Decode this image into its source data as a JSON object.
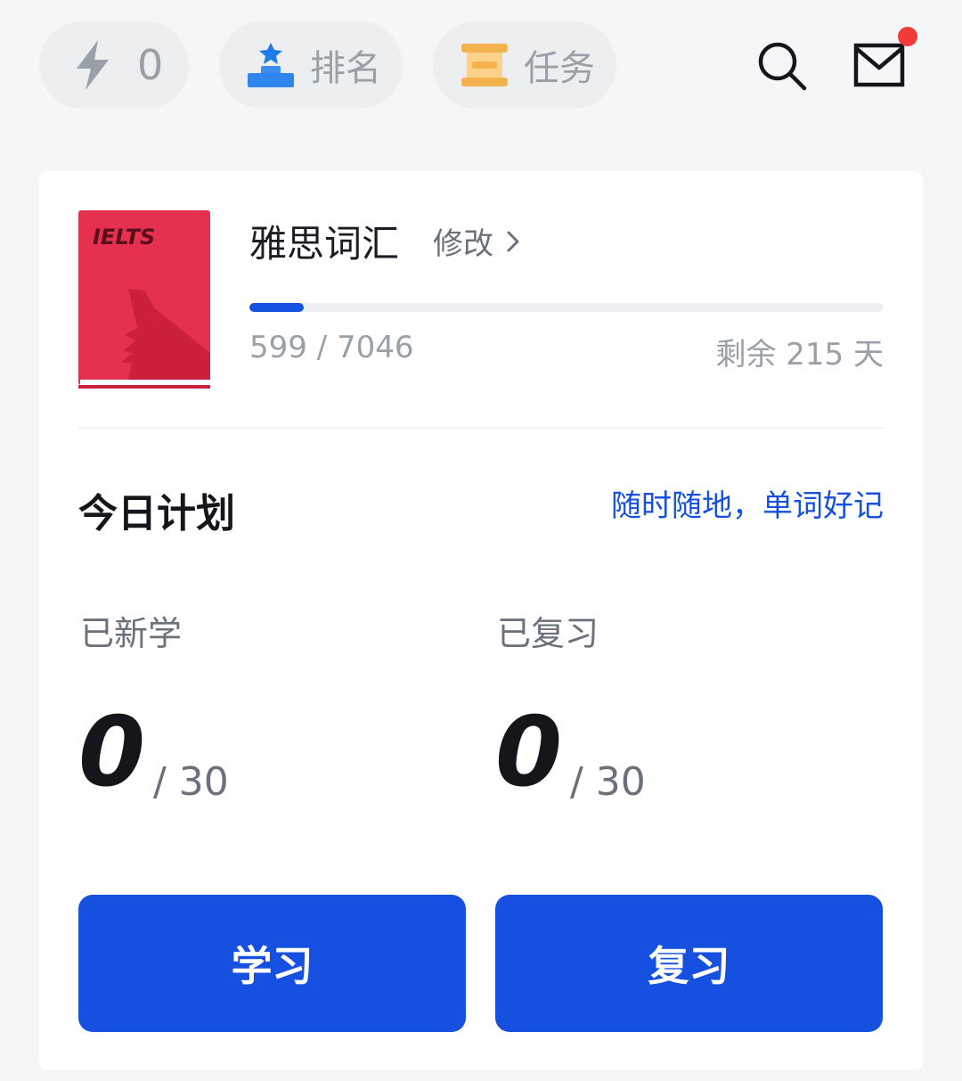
{
  "header": {
    "energy": {
      "icon": "lightning-icon",
      "value": "0"
    },
    "rank": {
      "icon": "podium-star-icon",
      "label": "排名"
    },
    "task": {
      "icon": "scroll-icon",
      "label": "任务"
    },
    "search_icon": "search-icon",
    "mail_icon": "mail-icon",
    "mail_has_notification": true,
    "notification_color": "#f23a3a"
  },
  "book": {
    "cover_text": "IELTS",
    "cover_color": "#e5304f",
    "title": "雅思词汇",
    "edit_label": "修改",
    "progress_current": 599,
    "progress_total": 7046,
    "progress_text": "599 / 7046",
    "remaining_text": "剩余 215 天"
  },
  "plan": {
    "title": "今日计划",
    "slogan": "随时随地，单词好记",
    "new": {
      "label": "已新学",
      "done": "0",
      "total": "/ 30"
    },
    "review": {
      "label": "已复习",
      "done": "0",
      "total": "/ 30"
    },
    "study_button": "学习",
    "review_button": "复习"
  },
  "colors": {
    "accent": "#1650e0",
    "background": "#f5f6f7"
  }
}
